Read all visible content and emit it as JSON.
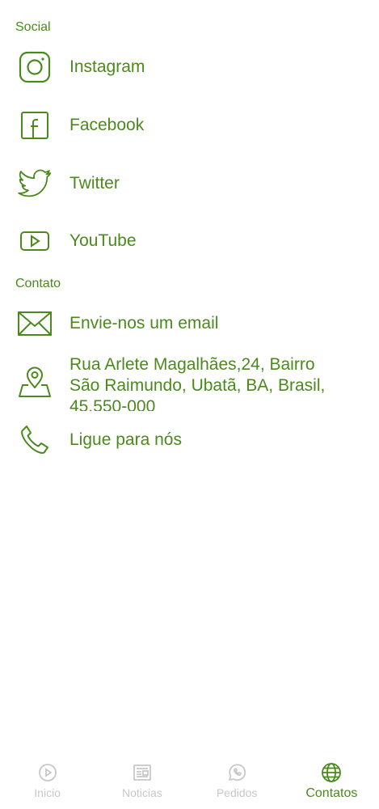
{
  "colors": {
    "accent": "#4a8a1c",
    "inactive": "#c8c8c8",
    "background": "#ffffff"
  },
  "sections": {
    "social_title": "Social",
    "contact_title": "Contato"
  },
  "social": [
    {
      "label": "Instagram",
      "icon": "instagram-icon"
    },
    {
      "label": "Facebook",
      "icon": "facebook-icon"
    },
    {
      "label": "Twitter",
      "icon": "twitter-icon"
    },
    {
      "label": "YouTube",
      "icon": "youtube-icon"
    }
  ],
  "contact": {
    "email": {
      "label": "Envie-nos um email",
      "icon": "mail-icon"
    },
    "address": {
      "label": "Rua Arlete Magalhães,24, Bairro São Raimundo, Ubatã, BA, Brasil, 45.550-000",
      "icon": "map-pin-icon"
    },
    "phone": {
      "label": "Ligue para nós",
      "icon": "phone-icon"
    }
  },
  "bottom_nav": [
    {
      "label": "Inicio",
      "icon": "play-icon",
      "active": false
    },
    {
      "label": "Noticias",
      "icon": "newspaper-icon",
      "active": false
    },
    {
      "label": "Pedidos",
      "icon": "whatsapp-icon",
      "active": false
    },
    {
      "label": "Contatos",
      "icon": "globe-icon",
      "active": true
    }
  ]
}
